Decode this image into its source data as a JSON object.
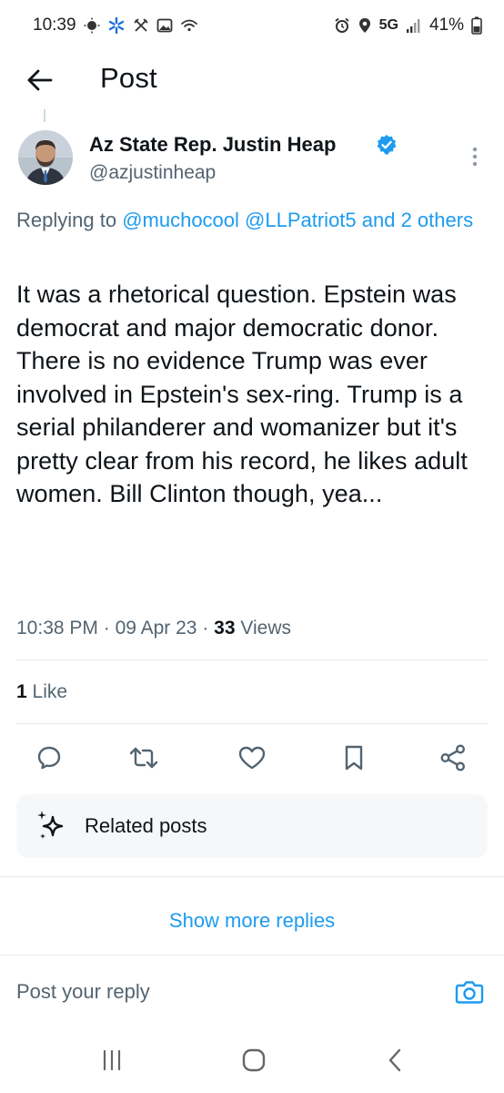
{
  "status_bar": {
    "time": "10:39",
    "network": "5G",
    "battery": "41%",
    "left_icons": [
      "weather-icon",
      "walmart-icon",
      "signal-off-icon",
      "gallery-icon",
      "wifi-call-icon"
    ],
    "right_icons": [
      "alarm-icon",
      "location-icon",
      "signal-icon",
      "battery-icon"
    ]
  },
  "header": {
    "title": "Post"
  },
  "post": {
    "author_name": "Az State Rep. Justin Heap",
    "author_handle": "@azjustinheap",
    "replying_prefix": "Replying to ",
    "replying_mentions": "@muchocool @LLPatriot5 and 2 others",
    "text": "It was a rhetorical question. Epstein was democrat and major democratic donor.\nThere is no evidence Trump was ever involved in Epstein's sex-ring. Trump is a serial philanderer and womanizer but it's pretty clear from his record, he likes adult women. Bill Clinton though, yea...",
    "time": "10:38 PM",
    "date": "09 Apr 23",
    "views_count": "33",
    "views_label": "Views",
    "likes_count": "1",
    "likes_label": "Like"
  },
  "actions": [
    "reply-icon",
    "repost-icon",
    "like-icon",
    "bookmark-icon",
    "share-icon"
  ],
  "related": {
    "label": "Related posts"
  },
  "show_more": "Show more replies",
  "reply_bar": {
    "placeholder": "Post your reply"
  },
  "colors": {
    "accent": "#1d9bf0",
    "text": "#0f1419",
    "muted": "#536471",
    "divider": "#e6e9eb",
    "card_bg": "#f5f7f8"
  }
}
